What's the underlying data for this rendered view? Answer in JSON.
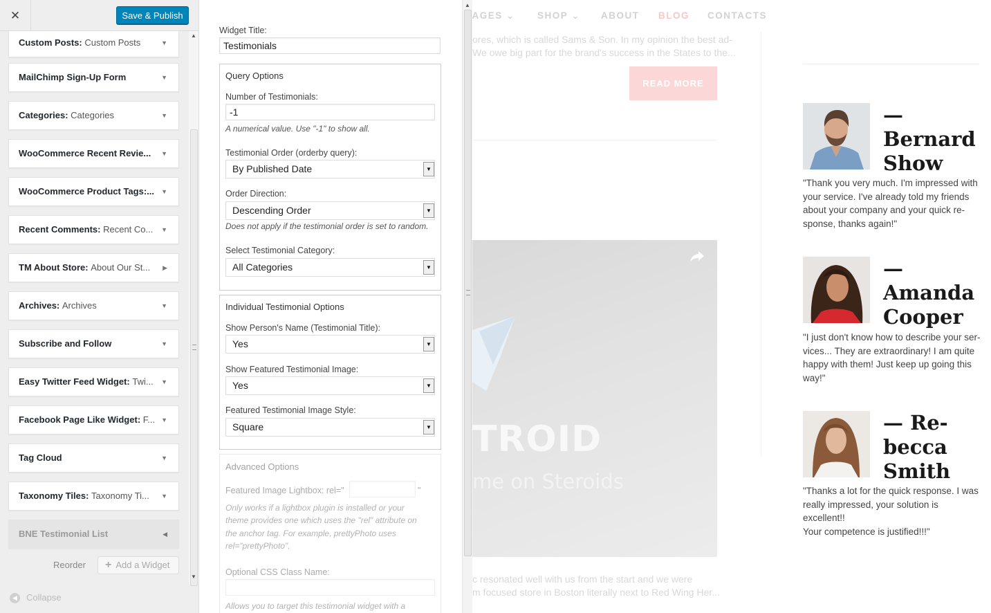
{
  "sidebar": {
    "close_icon": "close-icon",
    "publish_label": "Save & Publish",
    "widgets": [
      {
        "name": "Custom Posts",
        "title": "Custom Posts"
      },
      {
        "name": "MailChimp Sign-Up Form",
        "title": ""
      },
      {
        "name": "Categories",
        "title": "Categories"
      },
      {
        "name": "WooCommerce Recent Revie...",
        "title": ""
      },
      {
        "name": "WooCommerce Product Tags:...",
        "title": ""
      },
      {
        "name": "Recent Comments",
        "title": "Recent Co..."
      },
      {
        "name": "TM About Store",
        "title": "About Our St..."
      },
      {
        "name": "Archives",
        "title": "Archives"
      },
      {
        "name": "Subscribe and Follow",
        "title": ""
      },
      {
        "name": "Easy Twitter Feed Widget",
        "title": "Twi..."
      },
      {
        "name": "Facebook Page Like Widget",
        "title": "F..."
      },
      {
        "name": "Tag Cloud",
        "title": ""
      },
      {
        "name": "Taxonomy Tiles",
        "title": "Taxonomy Ti..."
      },
      {
        "name": "BNE Testimonial List",
        "title": ""
      }
    ],
    "reorder_label": "Reorder",
    "add_widget_label": "Add a Widget",
    "collapse_label": "Collapse"
  },
  "form": {
    "widget_title_label": "Widget Title:",
    "widget_title_value": "Testimonials",
    "query_options": {
      "legend": "Query Options",
      "count_label": "Number of Testimonials:",
      "count_value": "-1",
      "count_hint": "A numerical value. Use \"-1\" to show all.",
      "order_label": "Testimonial Order (orderby query):",
      "order_value": "By Published Date",
      "direction_label": "Order Direction:",
      "direction_value": "Descending Order",
      "direction_hint": "Does not apply if the testimonial order is set to random.",
      "category_label": "Select Testimonial Category:",
      "category_value": "All Categories"
    },
    "individual_options": {
      "legend": "Individual Testimonial Options",
      "show_name_label": "Show Person's Name (Testimonial Title):",
      "show_name_value": "Yes",
      "show_image_label": "Show Featured Testimonial Image:",
      "show_image_value": "Yes",
      "image_style_label": "Featured Testimonial Image Style:",
      "image_style_value": "Square"
    },
    "advanced_options": {
      "legend": "Advanced Options",
      "lightbox_label": "Featured Image Lightbox: rel=\"",
      "lightbox_suffix": "\"",
      "lightbox_hint_lines": [
        "Only works if a lightbox plugin is installed or your",
        "theme provides one which uses the \"rel\" attribute on",
        "the anchor tag. For example, prettyPhoto uses",
        "rel=\"prettyPhoto\"."
      ],
      "css_label": "Optional CSS Class Name:",
      "css_hint": "Allows you to target this testimonial widget with a"
    }
  },
  "preview": {
    "nav": [
      "PAGES",
      "SHOP",
      "ABOUT",
      "BLOG",
      "CONTACTS"
    ],
    "active_nav": "BLOG",
    "excerpt_lines": [
      "ores, which is called Sams & Son. In my opinion the best ad-",
      "We owe big part for the brand's success in the States to the..."
    ],
    "read_more_label": "READ MORE",
    "video_title": "TROID",
    "video_subtitle": "me on Steroids",
    "bottom_lines": [
      "c resonated well with us from the start and we were",
      "m focused store in Boston literally next to Red Wing Her..."
    ],
    "testimonials": [
      {
        "name_lines": [
          "—",
          "Bernard",
          "Show"
        ],
        "quote_lines": [
          "\"Thank you very much. I'm impressed with",
          "your service. I've already told my friends",
          "about your company and your quick re-",
          "sponse, thanks again!\""
        ]
      },
      {
        "name_lines": [
          "—",
          "Amanda",
          "Cooper"
        ],
        "quote_lines": [
          "\"I just don't know how to describe your ser-",
          "vices... They are extraordinary! I am quite",
          "happy with them! Just keep up going this",
          "way!\""
        ]
      },
      {
        "name_lines": [
          "— Re-",
          "becca",
          "Smith"
        ],
        "quote_lines": [
          "\"Thanks a lot for the quick response. I was",
          "really impressed, your solution is excellent!!",
          "Your competence is justified!!!\""
        ]
      }
    ]
  },
  "colors": {
    "publish": "#0085ba",
    "blog_active": "#f6c9c9",
    "read_more_bg": "#fcd7d7"
  }
}
